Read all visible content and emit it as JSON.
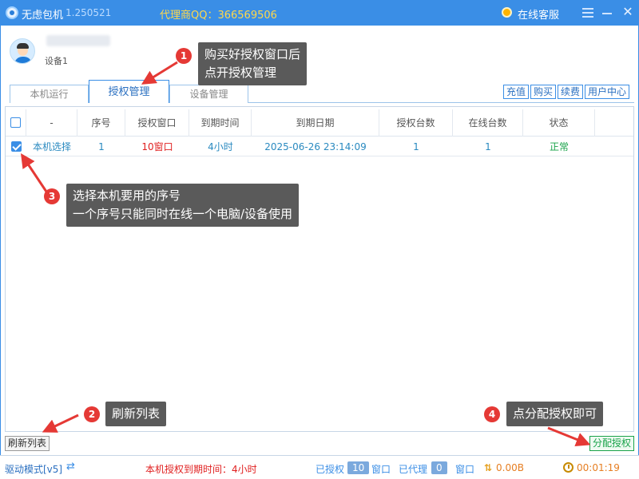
{
  "titlebar": {
    "app_name": "无虑包机",
    "version": "1.250521",
    "agent_qq": "代理商QQ：366569506",
    "online_service": "在线客服"
  },
  "user": {
    "device_name": "设备1"
  },
  "tabs": [
    {
      "label": "本机运行",
      "active": false
    },
    {
      "label": "授权管理",
      "active": true
    },
    {
      "label": "设备管理",
      "active": false
    }
  ],
  "actions": [
    "充值",
    "购买",
    "续费",
    "用户中心"
  ],
  "table": {
    "headers": [
      "-",
      "序号",
      "授权窗口",
      "到期时间",
      "到期日期",
      "授权台数",
      "在线台数",
      "状态"
    ],
    "rows": [
      {
        "checked": true,
        "select": "本机选择",
        "index": "1",
        "window": "10窗口",
        "expire_time": "4小时",
        "expire_date": "2025-06-26 23:14:09",
        "auth_count": "1",
        "online_count": "1",
        "status": "正常"
      }
    ]
  },
  "buttons": {
    "refresh": "刷新列表",
    "assign": "分配授权"
  },
  "statusbar": {
    "drive_mode": "驱动模式[v5]",
    "expire_text": "本机授权到期时间：4小时",
    "authorized_label": "已授权",
    "authorized_count": "10",
    "window_label_1": "窗口",
    "agent_label": "已代理",
    "agent_count": "0",
    "window_label_2": "窗口",
    "speed": "0.00B",
    "timer": "00:01:19"
  },
  "annotations": {
    "n1": "1",
    "t1_line1": "购买好授权窗口后",
    "t1_line2": "点开授权管理",
    "n2": "2",
    "t2": "刷新列表",
    "n3": "3",
    "t3_line1": "选择本机要用的序号",
    "t3_line2": "一个序号只能同时在线一个电脑/设备使用",
    "n4": "4",
    "t4": "点分配授权即可"
  },
  "colors": {
    "accent": "#3a8ee6",
    "danger": "#e02020",
    "success": "#1aa34a",
    "callout": "#5a5a5a",
    "badge": "#e53935"
  }
}
